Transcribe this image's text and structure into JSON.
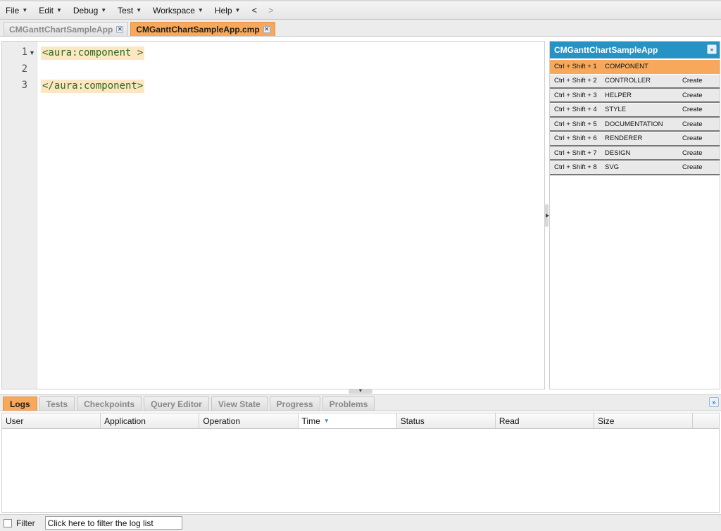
{
  "menu": {
    "items": [
      {
        "label": "File"
      },
      {
        "label": "Edit"
      },
      {
        "label": "Debug"
      },
      {
        "label": "Test"
      },
      {
        "label": "Workspace"
      },
      {
        "label": "Help"
      }
    ],
    "back_label": "<",
    "forward_label": ">"
  },
  "file_tabs": [
    {
      "label": "CMGanttChartSampleApp",
      "active": false
    },
    {
      "label": "CMGanttChartSampleApp.cmp",
      "active": true
    }
  ],
  "editor": {
    "lines": [
      {
        "number": "1",
        "code": "<aura:component >"
      },
      {
        "number": "2",
        "code": ""
      },
      {
        "number": "3",
        "code": "</aura:component>"
      }
    ]
  },
  "right_panel": {
    "title": "CMGanttChartSampleApp",
    "items": [
      {
        "shortcut": "Ctrl + Shift + 1",
        "name": "COMPONENT",
        "action": ""
      },
      {
        "shortcut": "Ctrl + Shift + 2",
        "name": "CONTROLLER",
        "action": "Create"
      },
      {
        "shortcut": "Ctrl + Shift + 3",
        "name": "HELPER",
        "action": "Create"
      },
      {
        "shortcut": "Ctrl + Shift + 4",
        "name": "STYLE",
        "action": "Create"
      },
      {
        "shortcut": "Ctrl + Shift + 5",
        "name": "DOCUMENTATION",
        "action": "Create"
      },
      {
        "shortcut": "Ctrl + Shift + 6",
        "name": "RENDERER",
        "action": "Create"
      },
      {
        "shortcut": "Ctrl + Shift + 7",
        "name": "DESIGN",
        "action": "Create"
      },
      {
        "shortcut": "Ctrl + Shift + 8",
        "name": "SVG",
        "action": "Create"
      }
    ]
  },
  "bottom_tabs": [
    {
      "label": "Logs",
      "active": true
    },
    {
      "label": "Tests",
      "active": false
    },
    {
      "label": "Checkpoints",
      "active": false
    },
    {
      "label": "Query Editor",
      "active": false
    },
    {
      "label": "View State",
      "active": false
    },
    {
      "label": "Progress",
      "active": false
    },
    {
      "label": "Problems",
      "active": false
    }
  ],
  "log_table": {
    "columns": [
      "User",
      "Application",
      "Operation",
      "Time",
      "Status",
      "Read",
      "Size"
    ],
    "sorted_column": "Time",
    "rows": []
  },
  "filter": {
    "label": "Filter",
    "input_value": "Click here to filter the log list"
  },
  "colors": {
    "accent_orange": "#f7a85a",
    "panel_header_blue": "#2693c4",
    "code_green": "#2a6e18",
    "code_highlight": "#fde6c4"
  }
}
